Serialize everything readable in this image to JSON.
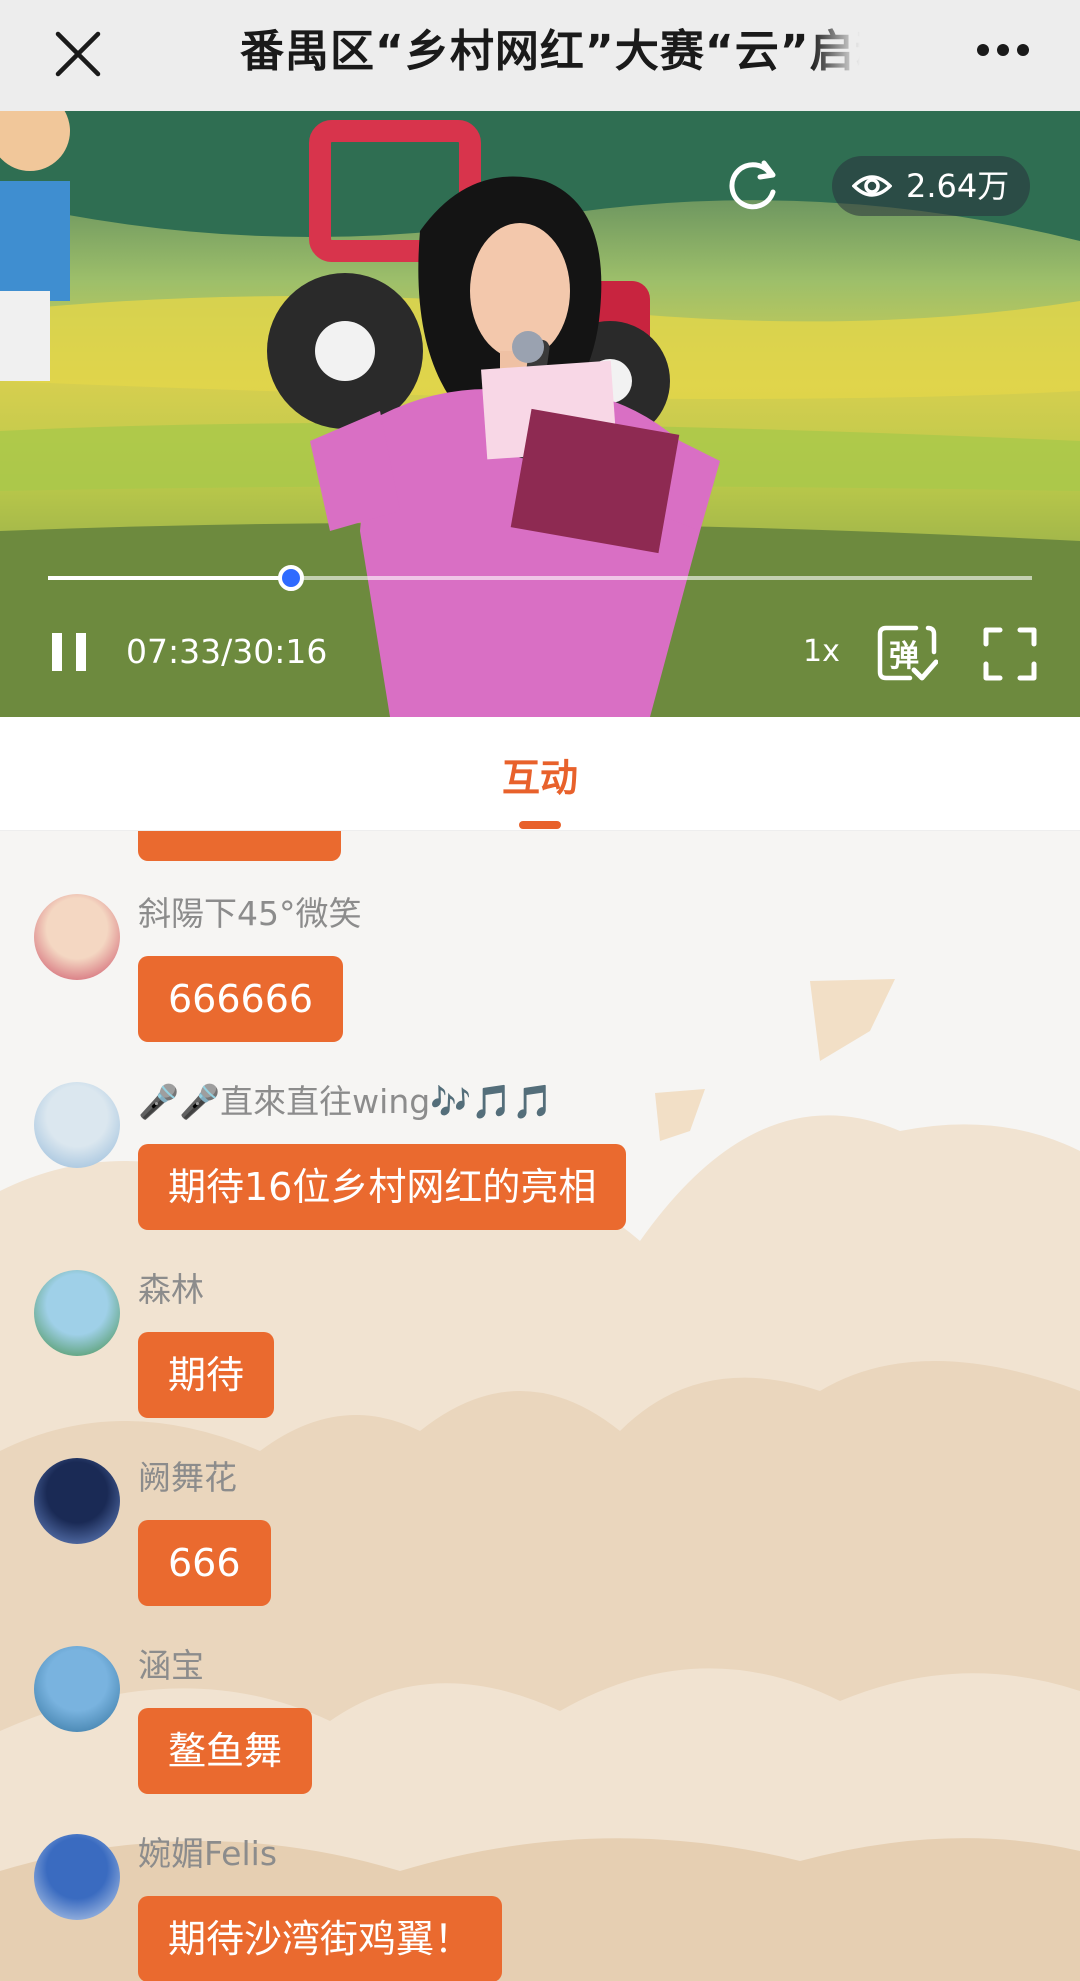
{
  "header": {
    "title": "番禺区“乡村网红”大赛“云”启动"
  },
  "video": {
    "views": "2.64万",
    "current_time": "07:33",
    "separator": "/",
    "total_time": "30:16",
    "progress": 0.247,
    "speed": "1x",
    "danmu_label": "弹"
  },
  "tabs": {
    "active": "互动"
  },
  "colors": {
    "accent": "#e8612b",
    "bubble": "#ea6a2f",
    "progress_knob": "#2f6bff"
  },
  "chat": {
    "messages": [
      {
        "user": "斜陽下45°微笑",
        "text": "666666"
      },
      {
        "user": "🎤🎤直來直往wing🎶🎵🎵",
        "text": "期待16位乡村网红的亮相"
      },
      {
        "user": "森林",
        "text": "期待"
      },
      {
        "user": "阙舞花",
        "text": "666"
      },
      {
        "user": "涵宝",
        "text": "鳌鱼舞"
      },
      {
        "user": "婉媚Felis",
        "text": "期待沙湾街鸡翼！"
      }
    ]
  }
}
